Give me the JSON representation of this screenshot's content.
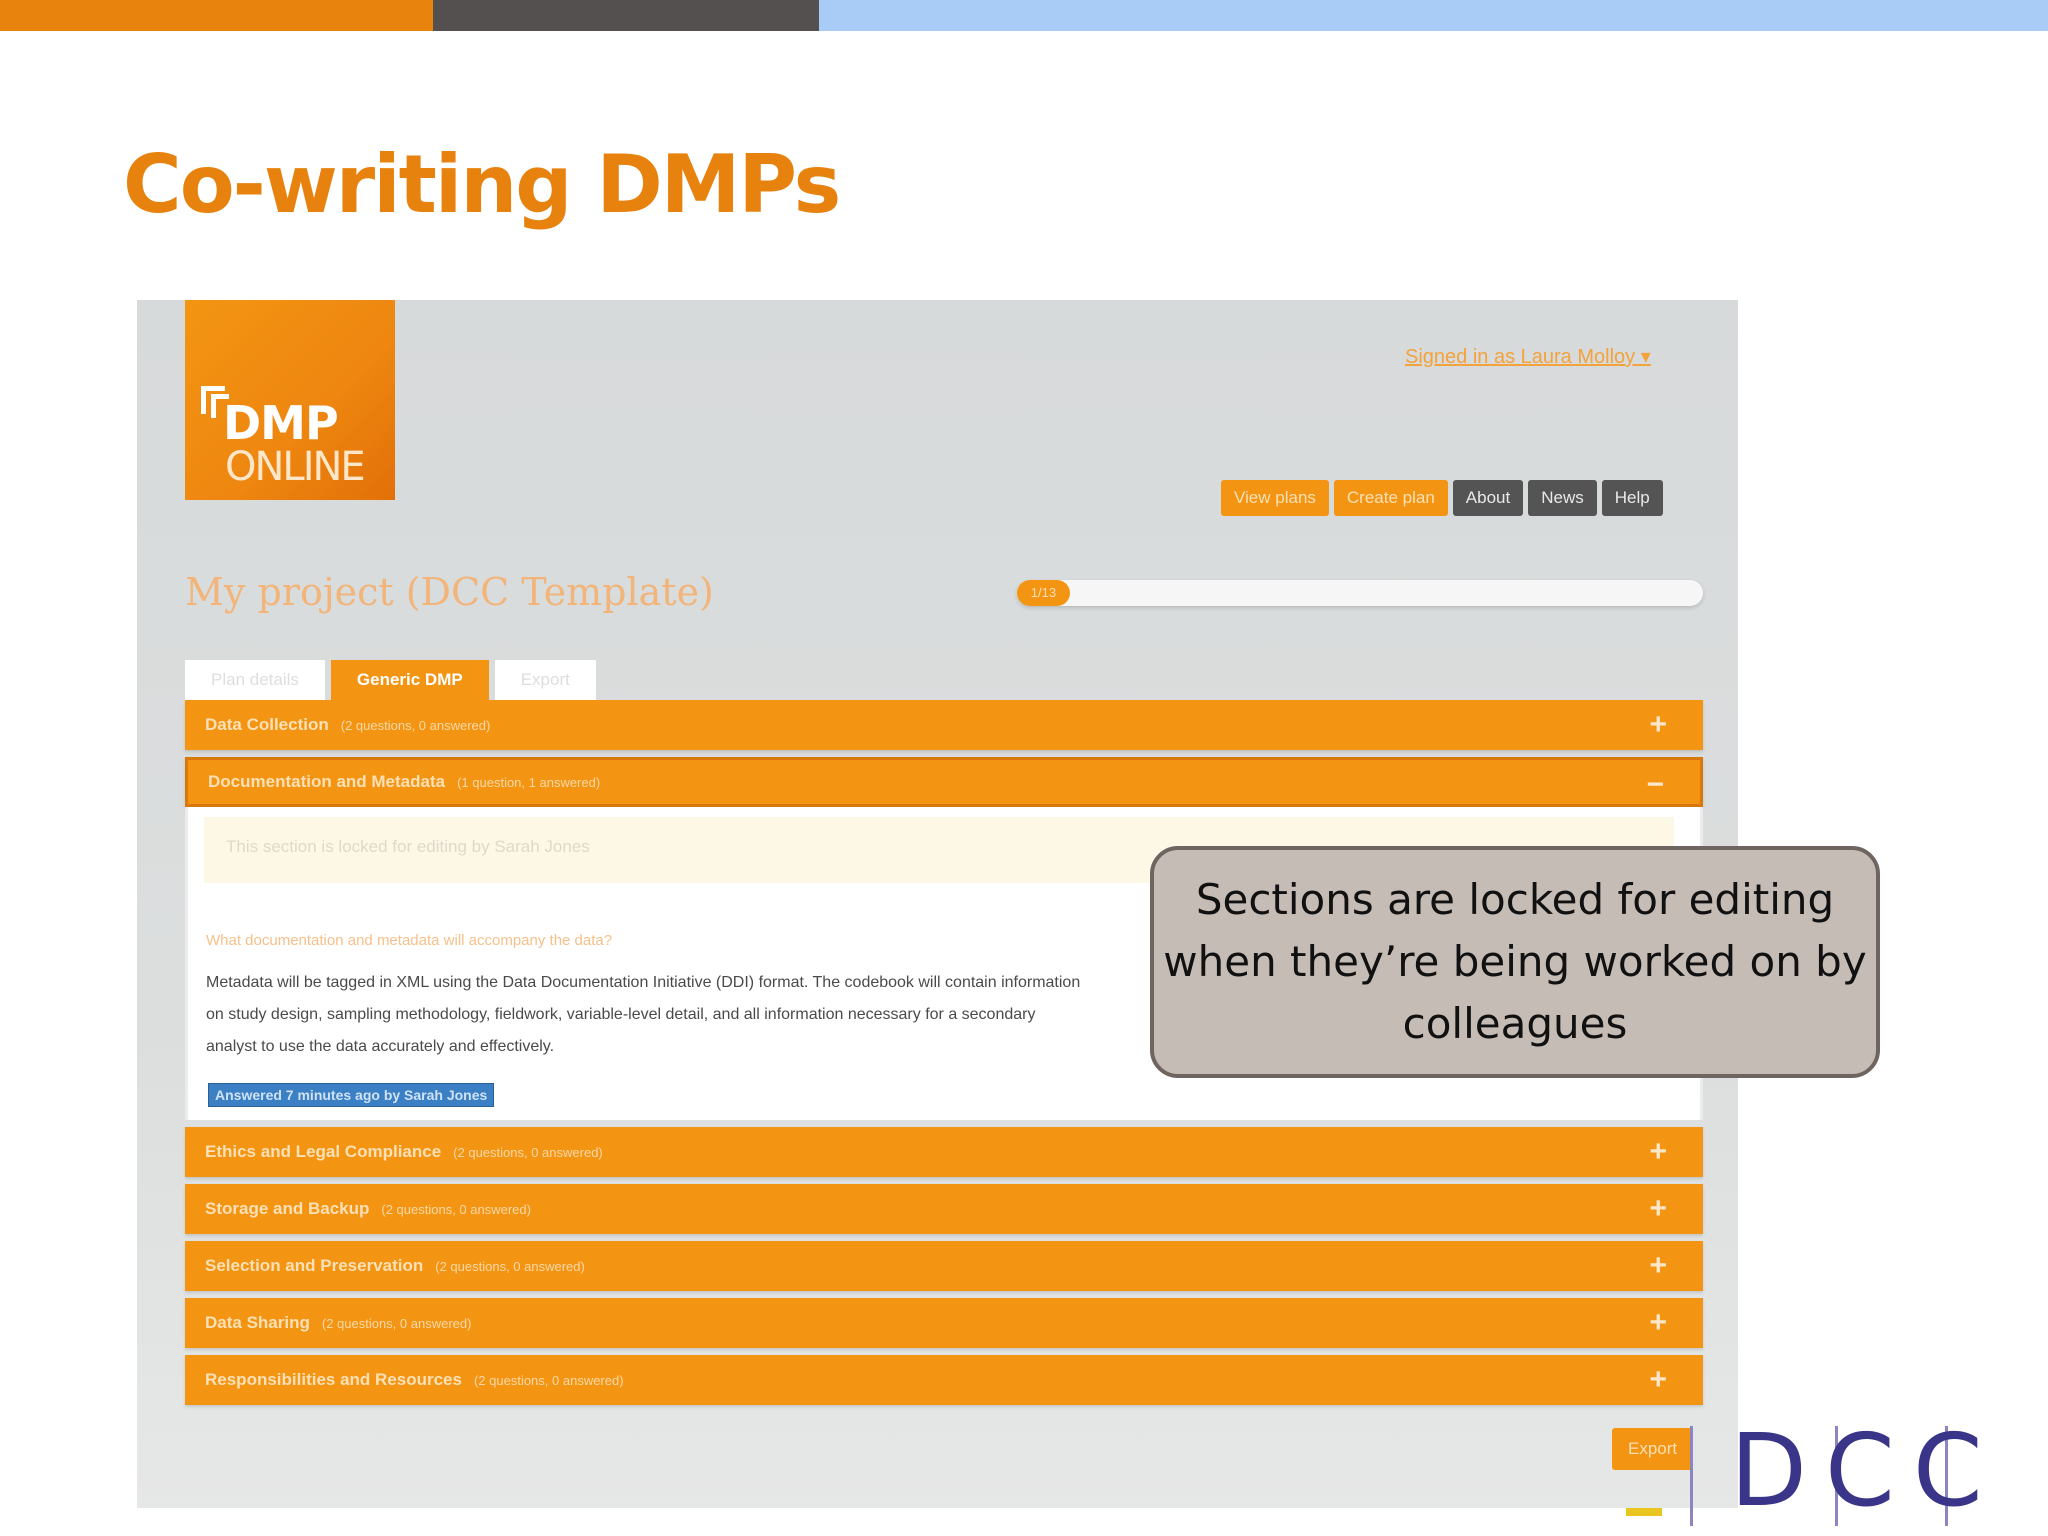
{
  "slide": {
    "title": "Co-writing DMPs",
    "callout": "Sections are locked for editing when they’re being worked on by colleagues",
    "logo_letters": "DCC"
  },
  "app": {
    "logo_line1": "DMP",
    "logo_line2": "ONLINE",
    "signed_in": "Signed in as Laura Molloy ▾",
    "nav": [
      "View plans",
      "Create plan",
      "About",
      "News",
      "Help"
    ],
    "project_title": "My project (DCC Template)",
    "progress": {
      "label": "1/13",
      "fraction": 0.077
    },
    "tabs": [
      "Plan details",
      "Generic DMP",
      "Export"
    ],
    "active_tab": "Generic DMP",
    "sections": [
      {
        "name": "Data Collection",
        "meta": "(2 questions, 0 answered)",
        "sign": "+"
      },
      {
        "name": "Documentation and Metadata",
        "meta": "(1 question, 1 answered)",
        "sign": "−"
      },
      {
        "name": "Ethics and Legal Compliance",
        "meta": "(2 questions, 0 answered)",
        "sign": "+"
      },
      {
        "name": "Storage and Backup",
        "meta": "(2 questions, 0 answered)",
        "sign": "+"
      },
      {
        "name": "Selection and Preservation",
        "meta": "(2 questions, 0 answered)",
        "sign": "+"
      },
      {
        "name": "Data Sharing",
        "meta": "(2 questions, 0 answered)",
        "sign": "+"
      },
      {
        "name": "Responsibilities and Resources",
        "meta": "(2 questions, 0 answered)",
        "sign": "+"
      }
    ],
    "open_section": {
      "locked_notice": "This section is locked for editing by Sarah Jones",
      "question": "What documentation and metadata will accompany the data?",
      "answer": "Metadata will be tagged in XML using the Data Documentation Initiative (DDI) format. The codebook will contain information on study design, sampling methodology, fieldwork, variable-level detail, and all information necessary for a secondary analyst to use the data accurately and effectively.",
      "answered_badge": "Answered 7 minutes ago by Sarah Jones"
    },
    "export_button": "Export"
  },
  "colors": {
    "accent_orange": "#f39512",
    "title_orange": "#e8820e",
    "dark_gray": "#545454",
    "light_blue": "#a8ccf5",
    "badge_blue": "#3b7fc4",
    "dcc_purple": "#3a3588"
  }
}
